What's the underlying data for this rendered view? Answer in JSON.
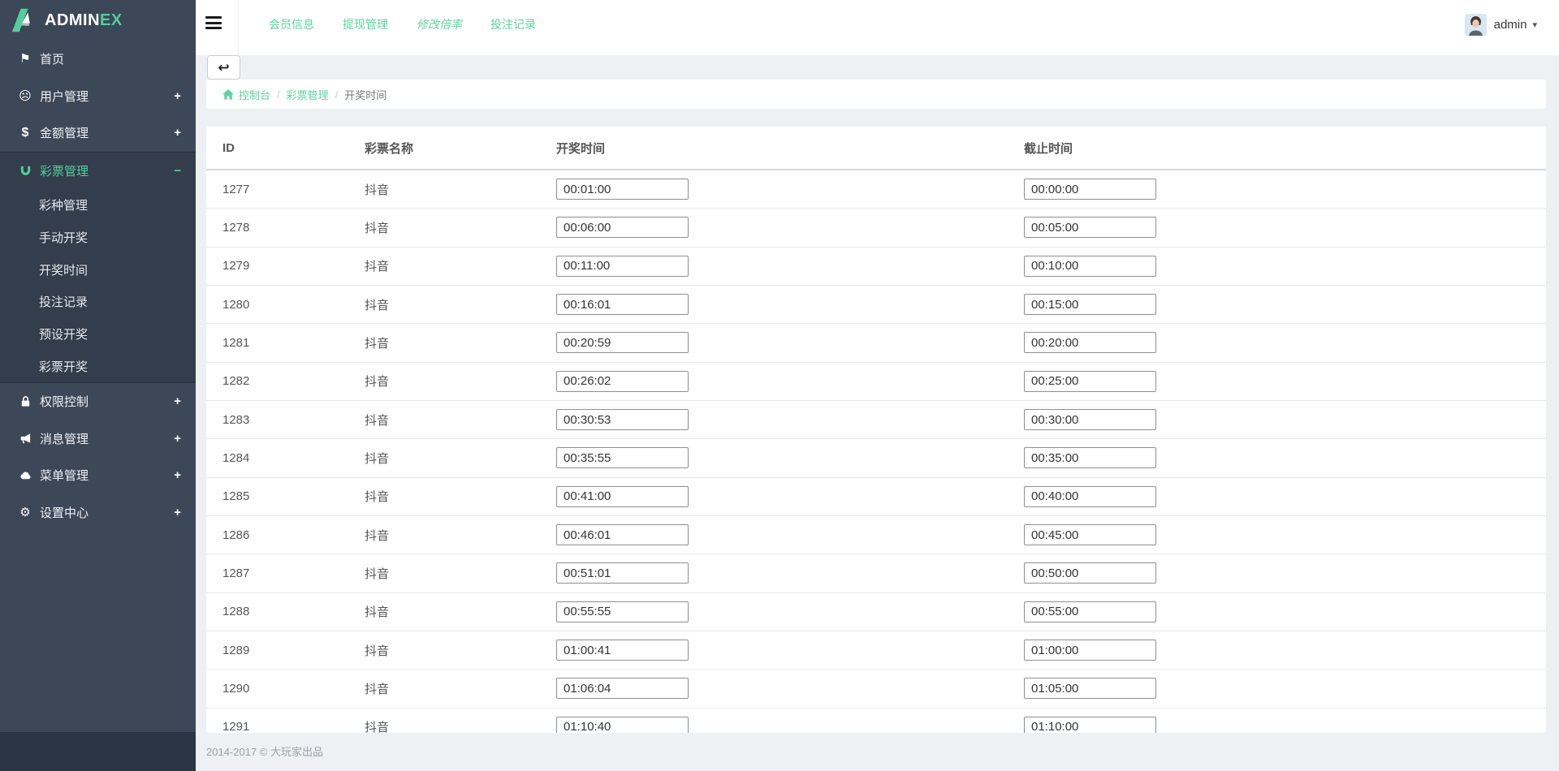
{
  "logo": {
    "admin": "ADMIN",
    "ex": "EX"
  },
  "topnav": {
    "links": [
      {
        "label": "会员信息",
        "italic": false
      },
      {
        "label": "提现管理",
        "italic": false
      },
      {
        "label": "修改倍率",
        "italic": true
      },
      {
        "label": "投注记录",
        "italic": false
      }
    ],
    "user": {
      "name": "admin"
    }
  },
  "icons": {
    "menu": "hamburger-icon",
    "back": "back-arrow-icon",
    "breadcrumb_home": "home-icon",
    "user_caret": "caret-down-icon",
    "user_avatar": "avatar"
  },
  "breadcrumb": {
    "items": [
      {
        "label": "控制台",
        "link": true,
        "home_icon": true
      },
      {
        "label": "彩票管理",
        "link": true,
        "home_icon": false
      },
      {
        "label": "开奖时间",
        "link": false,
        "home_icon": false
      }
    ]
  },
  "sidebar": {
    "items": [
      {
        "label": "首页",
        "icon": "flag-icon",
        "has_children": false,
        "expanded": false,
        "active": false,
        "children": []
      },
      {
        "label": "用户管理",
        "icon": "user-face-icon",
        "has_children": true,
        "expanded": false,
        "active": false,
        "children": []
      },
      {
        "label": "金额管理",
        "icon": "dollar-icon",
        "has_children": true,
        "expanded": false,
        "active": false,
        "children": []
      },
      {
        "label": "彩票管理",
        "icon": "magnet-icon",
        "has_children": true,
        "expanded": true,
        "active": true,
        "children": [
          "彩种管理",
          "手动开奖",
          "开奖时间",
          "投注记录",
          "预设开奖",
          "彩票开奖"
        ]
      },
      {
        "label": "权限控制",
        "icon": "lock-icon",
        "has_children": true,
        "expanded": false,
        "active": false,
        "children": []
      },
      {
        "label": "消息管理",
        "icon": "megaphone-icon",
        "has_children": true,
        "expanded": false,
        "active": false,
        "children": []
      },
      {
        "label": "菜单管理",
        "icon": "cloud-icon",
        "has_children": true,
        "expanded": false,
        "active": false,
        "children": []
      },
      {
        "label": "设置中心",
        "icon": "gear-icon",
        "has_children": true,
        "expanded": false,
        "active": false,
        "children": []
      }
    ]
  },
  "table": {
    "headers": [
      "ID",
      "彩票名称",
      "开奖时间",
      "截止时间"
    ],
    "rows": [
      {
        "id": "1277",
        "name": "抖音",
        "open_time": "00:01:00",
        "close_time": "00:00:00"
      },
      {
        "id": "1278",
        "name": "抖音",
        "open_time": "00:06:00",
        "close_time": "00:05:00"
      },
      {
        "id": "1279",
        "name": "抖音",
        "open_time": "00:11:00",
        "close_time": "00:10:00"
      },
      {
        "id": "1280",
        "name": "抖音",
        "open_time": "00:16:01",
        "close_time": "00:15:00"
      },
      {
        "id": "1281",
        "name": "抖音",
        "open_time": "00:20:59",
        "close_time": "00:20:00"
      },
      {
        "id": "1282",
        "name": "抖音",
        "open_time": "00:26:02",
        "close_time": "00:25:00"
      },
      {
        "id": "1283",
        "name": "抖音",
        "open_time": "00:30:53",
        "close_time": "00:30:00"
      },
      {
        "id": "1284",
        "name": "抖音",
        "open_time": "00:35:55",
        "close_time": "00:35:00"
      },
      {
        "id": "1285",
        "name": "抖音",
        "open_time": "00:41:00",
        "close_time": "00:40:00"
      },
      {
        "id": "1286",
        "name": "抖音",
        "open_time": "00:46:01",
        "close_time": "00:45:00"
      },
      {
        "id": "1287",
        "name": "抖音",
        "open_time": "00:51:01",
        "close_time": "00:50:00"
      },
      {
        "id": "1288",
        "name": "抖音",
        "open_time": "00:55:55",
        "close_time": "00:55:00"
      },
      {
        "id": "1289",
        "name": "抖音",
        "open_time": "01:00:41",
        "close_time": "01:00:00"
      },
      {
        "id": "1290",
        "name": "抖音",
        "open_time": "01:06:04",
        "close_time": "01:05:00"
      },
      {
        "id": "1291",
        "name": "抖音",
        "open_time": "01:10:40",
        "close_time": "01:10:00"
      }
    ]
  },
  "footer": {
    "copyright": "2014-2017 © 大玩家出品"
  },
  "colors": {
    "accent_green": "#55cd9c",
    "sidebar_bg": "#3c4758",
    "sidebar_submenu_bg": "#333d4b",
    "content_bg": "#eef0f3",
    "input_border": "#8f8f8f"
  }
}
